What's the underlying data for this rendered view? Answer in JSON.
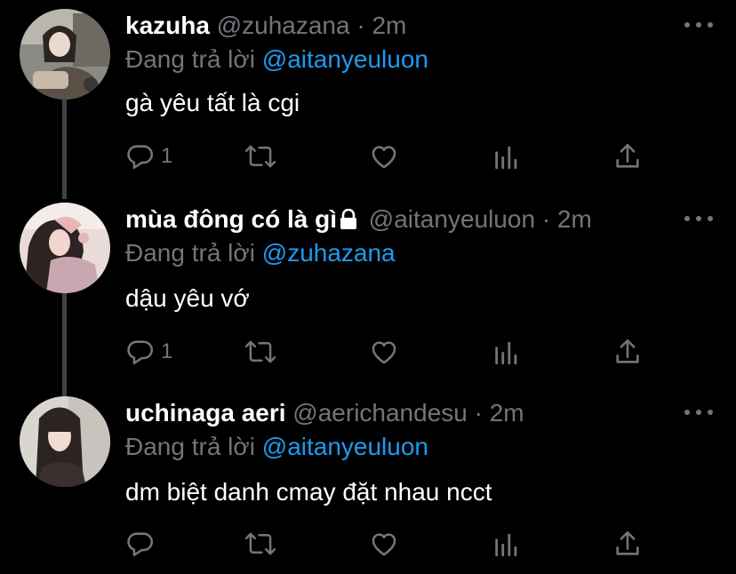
{
  "tweets": [
    {
      "display_name": "kazuha",
      "handle": "@zuhazana",
      "separator": "·",
      "time": "2m",
      "locked": false,
      "replying_prefix": "Đang trả lời",
      "replying_to": "@aitanyeuluon",
      "text": "gà yêu tất là cgi",
      "reply_count": "1",
      "avatar_icon": "user-avatar-photo"
    },
    {
      "display_name": "mùa đông có là gì",
      "handle": "@aitanyeuluon",
      "separator": "·",
      "time": "2m",
      "locked": true,
      "replying_prefix": "Đang trả lời",
      "replying_to": "@zuhazana",
      "text": "dậu yêu vớ",
      "reply_count": "1",
      "avatar_icon": "user-avatar-photo"
    },
    {
      "display_name": "uchinaga aeri",
      "handle": "@aerichandesu",
      "separator": "·",
      "time": "2m",
      "locked": false,
      "replying_prefix": "Đang trả lời",
      "replying_to": "@aitanyeuluon",
      "text": "dm biệt danh cmay đặt nhau ncct",
      "reply_count": "",
      "avatar_icon": "user-avatar-photo"
    }
  ],
  "icons": {
    "reply": "reply-icon",
    "retweet": "retweet-icon",
    "like": "like-icon",
    "analytics": "analytics-icon",
    "share": "share-icon",
    "more": "more-icon",
    "lock": "lock-icon"
  },
  "colors": {
    "background": "#000000",
    "text_primary": "#ffffff",
    "text_secondary": "#71767b",
    "link": "#1d9bf0",
    "thread_line": "#3e4144"
  }
}
